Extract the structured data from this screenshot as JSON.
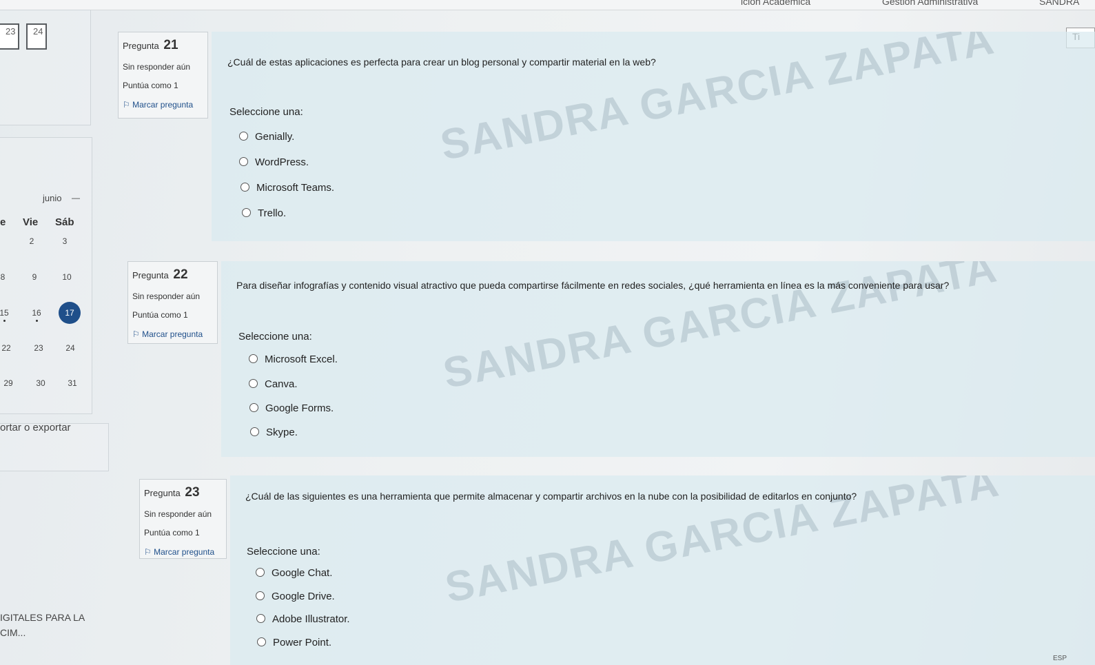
{
  "topbar": {
    "partial_item_1": "ición Académica",
    "partial_item_2": "Gestión Administrativa",
    "user": "SANDRA"
  },
  "quiz_nav": {
    "buttons": [
      "23",
      "24"
    ]
  },
  "calendar": {
    "month": "junio",
    "headers": [
      "e",
      "Vie",
      "Sáb"
    ],
    "rows": [
      [
        "",
        "2",
        "3"
      ],
      [
        "8",
        "9",
        "10"
      ],
      [
        "15",
        "16",
        "17"
      ],
      [
        "22",
        "23",
        "24"
      ],
      [
        "29",
        "30",
        "31"
      ]
    ],
    "today": "17"
  },
  "sidebar": {
    "export_link": "ortar o exportar",
    "course_line_1": "IGITALES PARA LA",
    "course_line_2": "CIM..."
  },
  "timer_label": "Ti",
  "watermark": "SANDRA GARCIA ZAPATA",
  "questions": [
    {
      "label": "Pregunta",
      "number": "21",
      "status": "Sin responder aún",
      "score": "Puntúa como 1",
      "flag": "Marcar pregunta",
      "text": "¿Cuál de estas aplicaciones es perfecta para crear un blog personal y compartir material en la web?",
      "prompt": "Seleccione una:",
      "options": [
        "Genially.",
        "WordPress.",
        "Microsoft Teams.",
        "Trello."
      ]
    },
    {
      "label": "Pregunta",
      "number": "22",
      "status": "Sin responder aún",
      "score": "Puntúa como 1",
      "flag": "Marcar pregunta",
      "text": "Para diseñar infografías y contenido visual atractivo que pueda compartirse fácilmente en redes sociales, ¿qué herramienta en línea es la más conveniente para usar?",
      "prompt": "Seleccione una:",
      "options": [
        "Microsoft Excel.",
        "Canva.",
        "Google Forms.",
        "Skype."
      ]
    },
    {
      "label": "Pregunta",
      "number": "23",
      "status": "Sin responder aún",
      "score": "Puntúa como 1",
      "flag": "Marcar pregunta",
      "text": "¿Cuál de las siguientes es una herramienta que permite almacenar y compartir archivos en la nube con la posibilidad de editarlos en conjunto?",
      "prompt": "Seleccione una:",
      "options": [
        "Google Chat.",
        "Google Drive.",
        "Adobe Illustrator.",
        "Power Point."
      ]
    }
  ],
  "taskbar": {
    "lang": "ESP"
  }
}
